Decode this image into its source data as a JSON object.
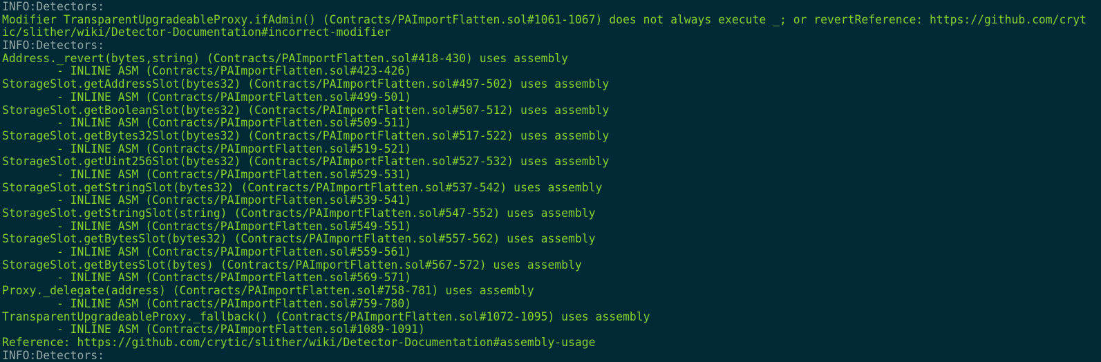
{
  "colors": {
    "background": "#012a36",
    "info": "#98a6a6",
    "output": "#86d130"
  },
  "terminal": {
    "lines": [
      {
        "type": "info",
        "text": "INFO:Detectors:"
      },
      {
        "type": "out",
        "text": "Modifier TransparentUpgradeableProxy.ifAdmin() (Contracts/PAImportFlatten.sol#1061-1067) does not always execute _; or revertReference: https://github.com/cryt"
      },
      {
        "type": "out",
        "text": "ic/slither/wiki/Detector-Documentation#incorrect-modifier"
      },
      {
        "type": "info",
        "text": "INFO:Detectors:"
      },
      {
        "type": "out",
        "text": "Address._revert(bytes,string) (Contracts/PAImportFlatten.sol#418-430) uses assembly"
      },
      {
        "type": "out",
        "text": "        - INLINE ASM (Contracts/PAImportFlatten.sol#423-426)"
      },
      {
        "type": "out",
        "text": "StorageSlot.getAddressSlot(bytes32) (Contracts/PAImportFlatten.sol#497-502) uses assembly"
      },
      {
        "type": "out",
        "text": "        - INLINE ASM (Contracts/PAImportFlatten.sol#499-501)"
      },
      {
        "type": "out",
        "text": "StorageSlot.getBooleanSlot(bytes32) (Contracts/PAImportFlatten.sol#507-512) uses assembly"
      },
      {
        "type": "out",
        "text": "        - INLINE ASM (Contracts/PAImportFlatten.sol#509-511)"
      },
      {
        "type": "out",
        "text": "StorageSlot.getBytes32Slot(bytes32) (Contracts/PAImportFlatten.sol#517-522) uses assembly"
      },
      {
        "type": "out",
        "text": "        - INLINE ASM (Contracts/PAImportFlatten.sol#519-521)"
      },
      {
        "type": "out",
        "text": "StorageSlot.getUint256Slot(bytes32) (Contracts/PAImportFlatten.sol#527-532) uses assembly"
      },
      {
        "type": "out",
        "text": "        - INLINE ASM (Contracts/PAImportFlatten.sol#529-531)"
      },
      {
        "type": "out",
        "text": "StorageSlot.getStringSlot(bytes32) (Contracts/PAImportFlatten.sol#537-542) uses assembly"
      },
      {
        "type": "out",
        "text": "        - INLINE ASM (Contracts/PAImportFlatten.sol#539-541)"
      },
      {
        "type": "out",
        "text": "StorageSlot.getStringSlot(string) (Contracts/PAImportFlatten.sol#547-552) uses assembly"
      },
      {
        "type": "out",
        "text": "        - INLINE ASM (Contracts/PAImportFlatten.sol#549-551)"
      },
      {
        "type": "out",
        "text": "StorageSlot.getBytesSlot(bytes32) (Contracts/PAImportFlatten.sol#557-562) uses assembly"
      },
      {
        "type": "out",
        "text": "        - INLINE ASM (Contracts/PAImportFlatten.sol#559-561)"
      },
      {
        "type": "out",
        "text": "StorageSlot.getBytesSlot(bytes) (Contracts/PAImportFlatten.sol#567-572) uses assembly"
      },
      {
        "type": "out",
        "text": "        - INLINE ASM (Contracts/PAImportFlatten.sol#569-571)"
      },
      {
        "type": "out",
        "text": "Proxy._delegate(address) (Contracts/PAImportFlatten.sol#758-781) uses assembly"
      },
      {
        "type": "out",
        "text": "        - INLINE ASM (Contracts/PAImportFlatten.sol#759-780)"
      },
      {
        "type": "out",
        "text": "TransparentUpgradeableProxy._fallback() (Contracts/PAImportFlatten.sol#1072-1095) uses assembly"
      },
      {
        "type": "out",
        "text": "        - INLINE ASM (Contracts/PAImportFlatten.sol#1089-1091)"
      },
      {
        "type": "out",
        "text": "Reference: https://github.com/crytic/slither/wiki/Detector-Documentation#assembly-usage"
      },
      {
        "type": "info",
        "text": "INFO:Detectors:"
      }
    ]
  }
}
